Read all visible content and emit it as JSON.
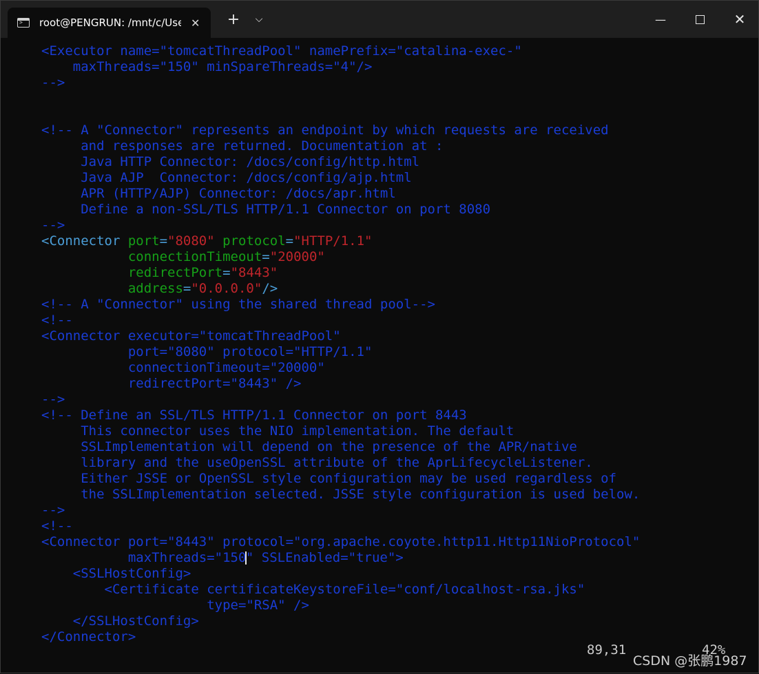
{
  "window": {
    "tab_title": "root@PENGRUN: /mnt/c/User",
    "tab_close": "✕",
    "new_tab": "+",
    "dropdown": "⌵",
    "minimize": "—",
    "close": "✕"
  },
  "editor": {
    "lines": [
      [
        "<Executor name=\"tomcatThreadPool\" namePrefix=\"catalina-exec-\""
      ],
      [
        "    maxThreads=\"150\" minSpareThreads=\"4\"/>"
      ],
      [
        "-->"
      ],
      [
        ""
      ],
      [
        ""
      ],
      [
        "<!-- A \"Connector\" represents an endpoint by which requests are received"
      ],
      [
        "     and responses are returned. Documentation at :"
      ],
      [
        "     Java HTTP Connector: /docs/config/http.html"
      ],
      [
        "     Java AJP  Connector: /docs/config/ajp.html"
      ],
      [
        "     APR (HTTP/AJP) Connector: /docs/apr.html"
      ],
      [
        "     Define a non-SSL/TLS HTTP/1.1 Connector on port 8080"
      ],
      [
        "-->"
      ],
      [
        "<Connector",
        " port",
        "=",
        "\"8080\"",
        " protocol",
        "=",
        "\"HTTP/1.1\""
      ],
      [
        "           connectionTimeout",
        "=",
        "\"20000\""
      ],
      [
        "           redirectPort",
        "=",
        "\"8443\""
      ],
      [
        "           address",
        "=",
        "\"0.0.0.0\"",
        "/>"
      ],
      [
        "<!-- A \"Connector\" using the shared thread pool-->"
      ],
      [
        "<!--"
      ],
      [
        "<Connector executor=\"tomcatThreadPool\""
      ],
      [
        "           port=\"8080\" protocol=\"HTTP/1.1\""
      ],
      [
        "           connectionTimeout=\"20000\""
      ],
      [
        "           redirectPort=\"8443\" />"
      ],
      [
        "-->"
      ],
      [
        "<!-- Define an SSL/TLS HTTP/1.1 Connector on port 8443"
      ],
      [
        "     This connector uses the NIO implementation. The default"
      ],
      [
        "     SSLImplementation will depend on the presence of the APR/native"
      ],
      [
        "     library and the useOpenSSL attribute of the AprLifecycleListener."
      ],
      [
        "     Either JSSE or OpenSSL style configuration may be used regardless of"
      ],
      [
        "     the SSLImplementation selected. JSSE style configuration is used below."
      ],
      [
        "-->"
      ],
      [
        "<!--"
      ],
      [
        "<Connector port=\"8443\" protocol=\"org.apache.coyote.http11.Http11NioProtocol\""
      ],
      [
        "           maxThreads=\"150",
        "\" SSLEnabled=\"true\">"
      ],
      [
        "    <SSLHostConfig>"
      ],
      [
        "        <Certificate certificateKeystoreFile=\"conf/localhost-rsa.jks\""
      ],
      [
        "                     type=\"RSA\" />"
      ],
      [
        "    </SSLHostConfig>"
      ],
      [
        "</Connector>"
      ]
    ],
    "cursor_position": "89,31",
    "scroll_percent": "42%"
  },
  "watermark": "CSDN @张鹏1987",
  "colors": {
    "background": "#0c0c0c",
    "comment": "#1a3dd6",
    "tag": "#4b9ed8",
    "attribute": "#16a018",
    "value": "#c0252b"
  }
}
